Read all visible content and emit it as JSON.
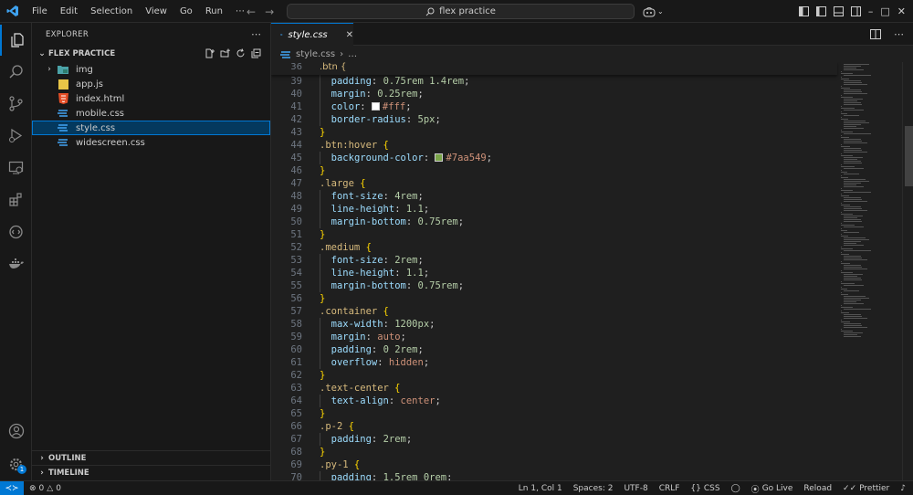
{
  "titlebar": {
    "menu": [
      "File",
      "Edit",
      "Selection",
      "View",
      "Go",
      "Run",
      "⋯"
    ],
    "search": "flex practice"
  },
  "sidebar": {
    "title": "EXPLORER",
    "folder": "FLEX PRACTICE",
    "items": [
      {
        "label": "img",
        "icon": "image-folder-icon",
        "folder": true
      },
      {
        "label": "app.js",
        "icon": "js-file-icon"
      },
      {
        "label": "index.html",
        "icon": "html-file-icon"
      },
      {
        "label": "mobile.css",
        "icon": "css-file-icon"
      },
      {
        "label": "style.css",
        "icon": "css-file-icon",
        "selected": true
      },
      {
        "label": "widescreen.css",
        "icon": "css-file-icon"
      }
    ],
    "outline": "OUTLINE",
    "timeline": "TIMELINE"
  },
  "editor": {
    "tab": "style.css",
    "breadcrumb_file": "style.css",
    "breadcrumb_more": "…",
    "sticky": {
      "ln": "36",
      "text": ".btn {"
    },
    "lines": [
      {
        "ln": "39",
        "indent": true,
        "prop": "padding",
        "value": "0.75rem 1.4rem"
      },
      {
        "ln": "40",
        "indent": true,
        "prop": "margin",
        "value": "0.25rem"
      },
      {
        "ln": "41",
        "indent": true,
        "prop": "color",
        "value": "#fff",
        "swatch": "#ffffff"
      },
      {
        "ln": "42",
        "indent": true,
        "prop": "border-radius",
        "value": "5px"
      },
      {
        "ln": "43",
        "close": "}"
      },
      {
        "ln": "44",
        "selector": ".btn:hover"
      },
      {
        "ln": "45",
        "indent": true,
        "prop": "background-color",
        "value": "#7aa549",
        "swatch": "#7aa549"
      },
      {
        "ln": "46",
        "close": "}"
      },
      {
        "ln": "47",
        "selector": ".large"
      },
      {
        "ln": "48",
        "indent": true,
        "prop": "font-size",
        "value": "4rem"
      },
      {
        "ln": "49",
        "indent": true,
        "prop": "line-height",
        "value": "1.1"
      },
      {
        "ln": "50",
        "indent": true,
        "prop": "margin-bottom",
        "value": "0.75rem"
      },
      {
        "ln": "51",
        "close": "}"
      },
      {
        "ln": "52",
        "selector": ".medium"
      },
      {
        "ln": "53",
        "indent": true,
        "prop": "font-size",
        "value": "2rem"
      },
      {
        "ln": "54",
        "indent": true,
        "prop": "line-height",
        "value": "1.1"
      },
      {
        "ln": "55",
        "indent": true,
        "prop": "margin-bottom",
        "value": "0.75rem"
      },
      {
        "ln": "56",
        "close": "}"
      },
      {
        "ln": "57",
        "selector": ".container"
      },
      {
        "ln": "58",
        "indent": true,
        "prop": "max-width",
        "value": "1200px"
      },
      {
        "ln": "59",
        "indent": true,
        "prop": "margin",
        "value": "auto"
      },
      {
        "ln": "60",
        "indent": true,
        "prop": "padding",
        "value": "0 2rem"
      },
      {
        "ln": "61",
        "indent": true,
        "prop": "overflow",
        "value": "hidden"
      },
      {
        "ln": "62",
        "close": "}"
      },
      {
        "ln": "63",
        "selector": ".text-center"
      },
      {
        "ln": "64",
        "indent": true,
        "prop": "text-align",
        "value": "center"
      },
      {
        "ln": "65",
        "close": "}"
      },
      {
        "ln": "66",
        "selector": ".p-2"
      },
      {
        "ln": "67",
        "indent": true,
        "prop": "padding",
        "value": "2rem"
      },
      {
        "ln": "68",
        "close": "}"
      },
      {
        "ln": "69",
        "selector": ".py-1"
      },
      {
        "ln": "70",
        "indent": true,
        "prop": "padding",
        "value": "1.5rem 0rem"
      }
    ]
  },
  "statusbar": {
    "errors": "0",
    "warnings": "0",
    "position": "Ln 1, Col 1",
    "spaces": "Spaces: 2",
    "encoding": "UTF-8",
    "eol": "CRLF",
    "language": "CSS",
    "golive": "Go Live",
    "reload": "Reload",
    "prettier": "Prettier"
  },
  "badge_count": "1",
  "colors": {
    "accent": "#0078d4",
    "selector": "#d7ba7d",
    "property": "#9cdcfe",
    "value": "#ce9178",
    "bracket": "#ffd700"
  }
}
